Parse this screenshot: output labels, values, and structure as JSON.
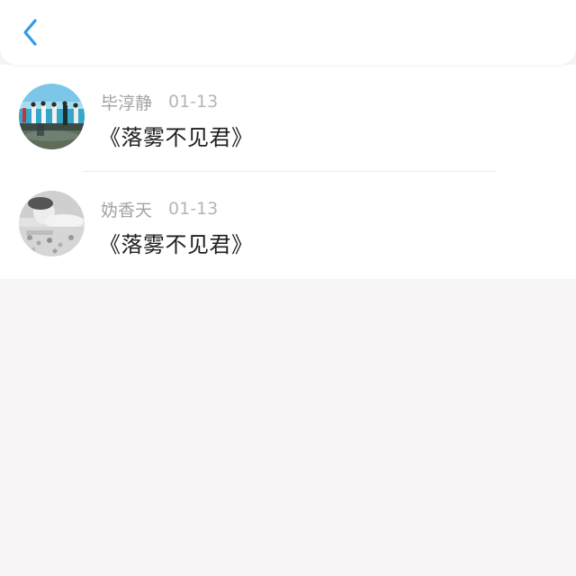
{
  "header": {
    "back_icon": "chevron-left-icon",
    "accent": "#2f9bea"
  },
  "comments": [
    {
      "author": "毕淳静",
      "date": "01-13",
      "text": "《落雾不见君》",
      "avatar_icon": "beach-group-photo-avatar"
    },
    {
      "author": "妫香天",
      "date": "01-13",
      "text": "《落雾不见君》",
      "avatar_icon": "grayscale-portrait-avatar"
    }
  ],
  "colors": {
    "page_background": "#f7f5f6",
    "card_background": "#ffffff",
    "author_text": "#a3a3a3",
    "content_text": "#1f1f1f"
  }
}
